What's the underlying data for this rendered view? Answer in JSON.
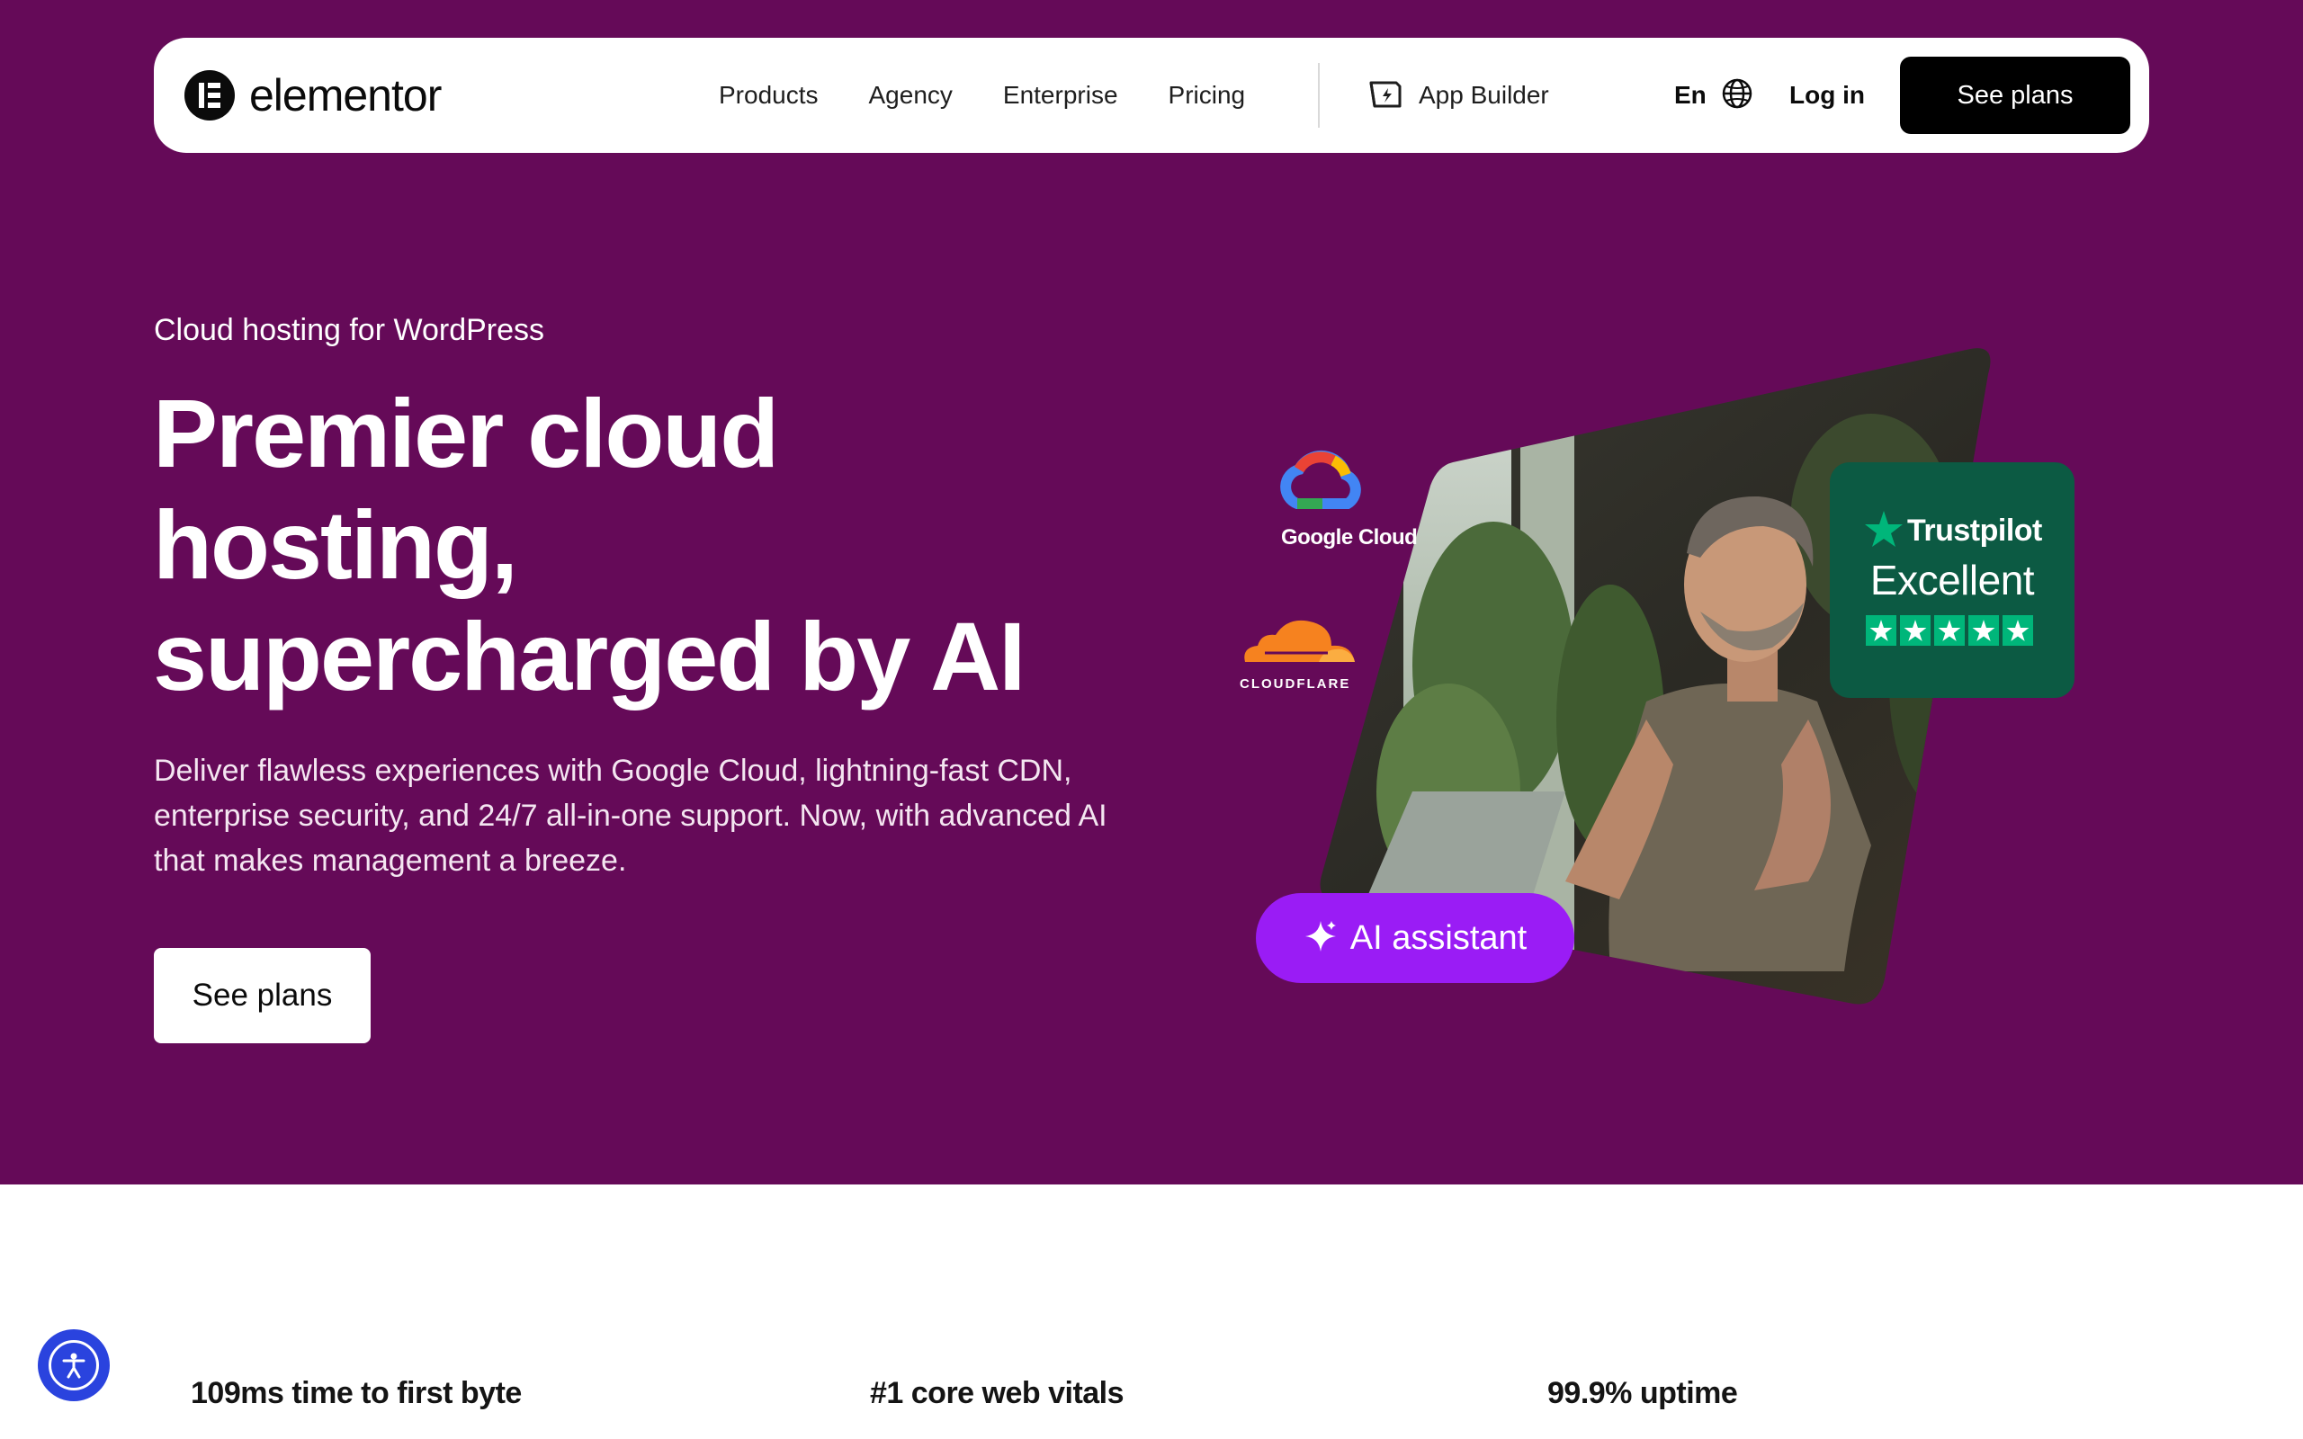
{
  "brand": {
    "name": "elementor"
  },
  "nav": {
    "links": [
      "Products",
      "Agency",
      "Enterprise",
      "Pricing"
    ],
    "app_builder": "App Builder",
    "language": "En",
    "login": "Log in",
    "cta": "See plans"
  },
  "hero": {
    "eyebrow": "Cloud hosting for WordPress",
    "headline": [
      "Premier cloud",
      "hosting,",
      "supercharged by AI"
    ],
    "subheadline": "Deliver flawless experiences with Google Cloud, lightning-fast CDN, enterprise security, and 24/7 all-in-one support. Now, with advanced AI that makes management a breeze.",
    "cta": "See plans"
  },
  "badges": {
    "google_cloud": "Google Cloud",
    "cloudflare": "CLOUDFLARE",
    "trustpilot": {
      "brand": "Trustpilot",
      "rating": "Excellent",
      "stars": 5
    },
    "ai_assistant": "AI assistant"
  },
  "stats": [
    "109ms time to first byte",
    "#1 core web vitals",
    "99.9% uptime"
  ],
  "colors": {
    "hero_bg": "#650a58",
    "ai_pill": "#9a1cf5",
    "trustpilot_card": "#0c5a43",
    "trustpilot_star": "#00b67a",
    "accessibility_button": "#2a43de"
  }
}
